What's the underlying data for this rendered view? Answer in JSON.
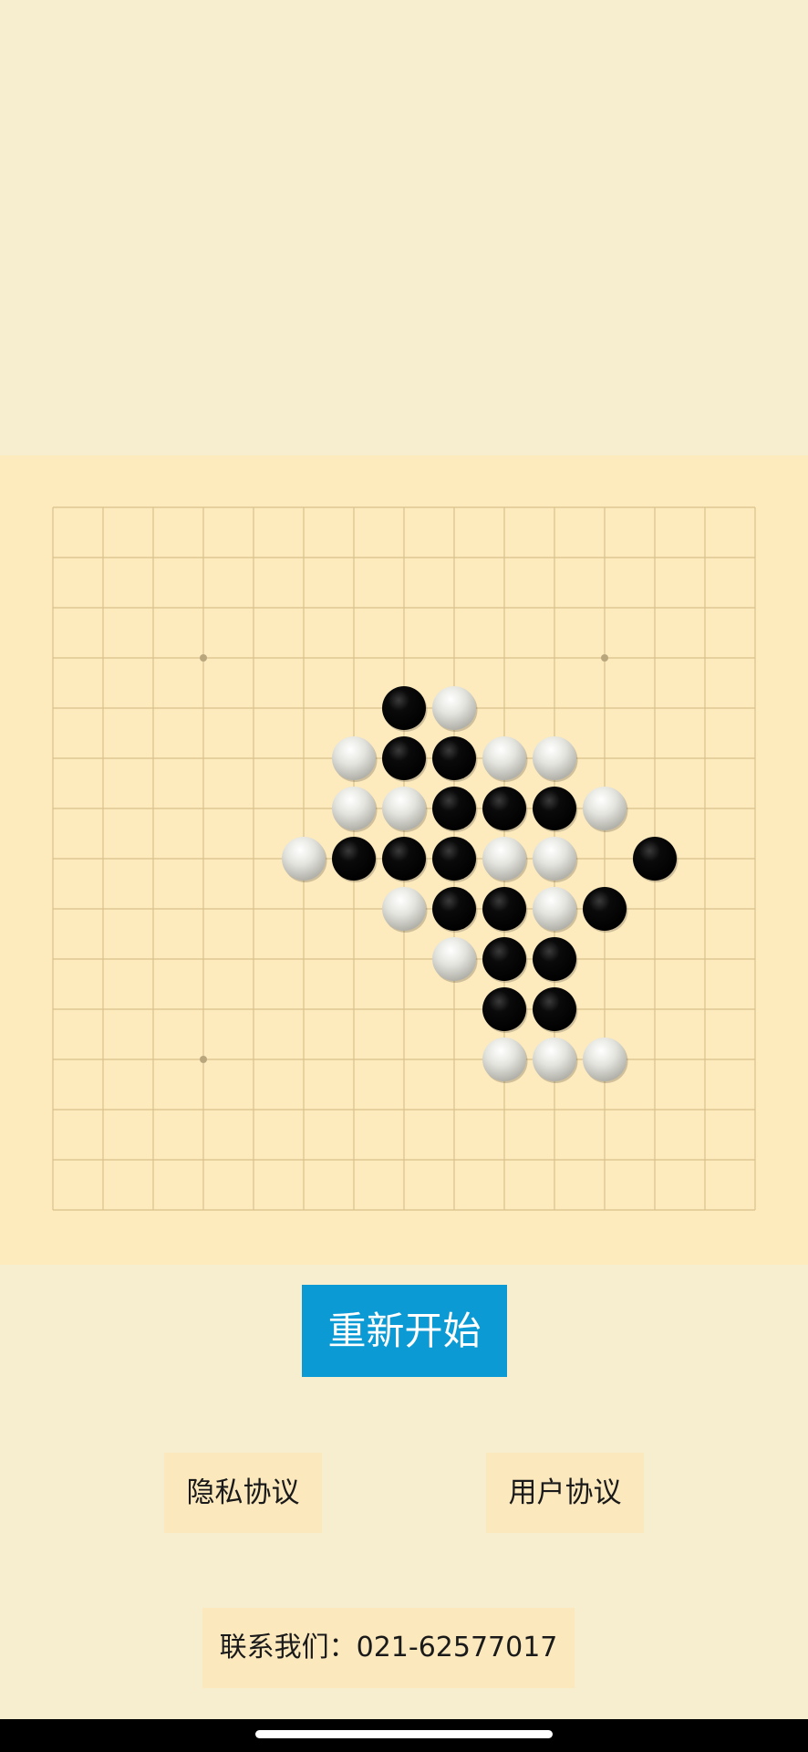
{
  "board": {
    "size": 15,
    "star_points": [
      [
        3,
        3
      ],
      [
        11,
        3
      ],
      [
        3,
        11
      ]
    ],
    "colors": {
      "board_background": "#fdeabd",
      "grid_line": "#d9c18d",
      "star_point": "#b9a67c",
      "black_stone": "#000000",
      "white_stone": "#d6d6cf"
    },
    "stones": [
      {
        "col": 7,
        "row": 4,
        "color": "black"
      },
      {
        "col": 8,
        "row": 4,
        "color": "white"
      },
      {
        "col": 6,
        "row": 5,
        "color": "white"
      },
      {
        "col": 7,
        "row": 5,
        "color": "black"
      },
      {
        "col": 8,
        "row": 5,
        "color": "black"
      },
      {
        "col": 9,
        "row": 5,
        "color": "white"
      },
      {
        "col": 10,
        "row": 5,
        "color": "white"
      },
      {
        "col": 6,
        "row": 6,
        "color": "white"
      },
      {
        "col": 7,
        "row": 6,
        "color": "white"
      },
      {
        "col": 8,
        "row": 6,
        "color": "black"
      },
      {
        "col": 9,
        "row": 6,
        "color": "black"
      },
      {
        "col": 10,
        "row": 6,
        "color": "black"
      },
      {
        "col": 11,
        "row": 6,
        "color": "white"
      },
      {
        "col": 5,
        "row": 7,
        "color": "white"
      },
      {
        "col": 6,
        "row": 7,
        "color": "black"
      },
      {
        "col": 7,
        "row": 7,
        "color": "black"
      },
      {
        "col": 8,
        "row": 7,
        "color": "black"
      },
      {
        "col": 9,
        "row": 7,
        "color": "white"
      },
      {
        "col": 10,
        "row": 7,
        "color": "white"
      },
      {
        "col": 12,
        "row": 7,
        "color": "black"
      },
      {
        "col": 7,
        "row": 8,
        "color": "white"
      },
      {
        "col": 8,
        "row": 8,
        "color": "black"
      },
      {
        "col": 9,
        "row": 8,
        "color": "black"
      },
      {
        "col": 10,
        "row": 8,
        "color": "white"
      },
      {
        "col": 11,
        "row": 8,
        "color": "black"
      },
      {
        "col": 8,
        "row": 9,
        "color": "white"
      },
      {
        "col": 9,
        "row": 9,
        "color": "black"
      },
      {
        "col": 10,
        "row": 9,
        "color": "black"
      },
      {
        "col": 9,
        "row": 10,
        "color": "black"
      },
      {
        "col": 10,
        "row": 10,
        "color": "black"
      },
      {
        "col": 9,
        "row": 11,
        "color": "white"
      },
      {
        "col": 10,
        "row": 11,
        "color": "white"
      },
      {
        "col": 11,
        "row": 11,
        "color": "white"
      }
    ]
  },
  "buttons": {
    "restart_label": "重新开始",
    "restart_color": "#0b9ad3",
    "privacy_label": "隐私协议",
    "user_agreement_label": "用户协议",
    "contact_label": "联系我们：021-62577017"
  },
  "page": {
    "background": "#f7edcf"
  }
}
